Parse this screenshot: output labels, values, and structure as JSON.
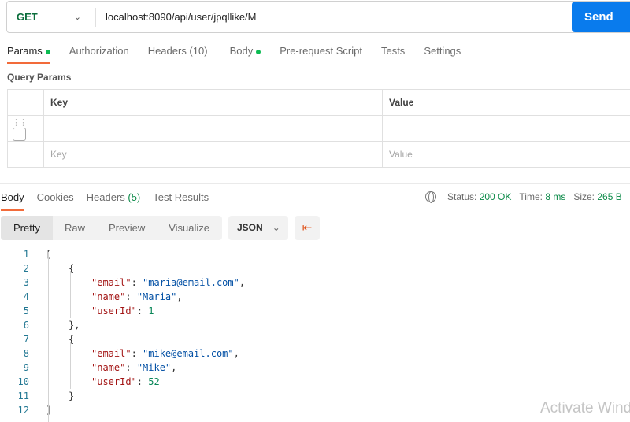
{
  "request": {
    "method": "GET",
    "url": "localhost:8090/api/user/jpqllike/M",
    "send_label": "Send"
  },
  "tabs": [
    "Params",
    "Authorization",
    "Headers (10)",
    "Body",
    "Pre-request Script",
    "Tests",
    "Settings"
  ],
  "query_params": {
    "title": "Query Params",
    "headers": [
      "Key",
      "Value"
    ],
    "placeholder_key": "Key",
    "placeholder_value": "Value"
  },
  "response": {
    "tabs": [
      "Body",
      "Cookies",
      "Headers",
      "Test Results"
    ],
    "headers_count": "(5)",
    "status_label": "Status:",
    "status": "200 OK",
    "time_label": "Time:",
    "time": "8 ms",
    "size_label": "Size:",
    "size": "265 B",
    "views": [
      "Pretty",
      "Raw",
      "Preview",
      "Visualize"
    ],
    "format": "JSON"
  },
  "code_lines": [
    [
      [
        "p",
        "["
      ]
    ],
    [
      [
        "p",
        "{"
      ]
    ],
    [
      [
        "k",
        "\"email\""
      ],
      [
        "p",
        ": "
      ],
      [
        "s",
        "\"maria@email.com\""
      ],
      [
        "p",
        ","
      ]
    ],
    [
      [
        "k",
        "\"name\""
      ],
      [
        "p",
        ": "
      ],
      [
        "s",
        "\"Maria\""
      ],
      [
        "p",
        ","
      ]
    ],
    [
      [
        "k",
        "\"userId\""
      ],
      [
        "p",
        ": "
      ],
      [
        "n",
        "1"
      ]
    ],
    [
      [
        "p",
        "},"
      ]
    ],
    [
      [
        "p",
        "{"
      ]
    ],
    [
      [
        "k",
        "\"email\""
      ],
      [
        "p",
        ": "
      ],
      [
        "s",
        "\"mike@email.com\""
      ],
      [
        "p",
        ","
      ]
    ],
    [
      [
        "k",
        "\"name\""
      ],
      [
        "p",
        ": "
      ],
      [
        "s",
        "\"Mike\""
      ],
      [
        "p",
        ","
      ]
    ],
    [
      [
        "k",
        "\"userId\""
      ],
      [
        "p",
        ": "
      ],
      [
        "n",
        "52"
      ]
    ],
    [
      [
        "p",
        "}"
      ]
    ],
    [
      [
        "p",
        "]"
      ]
    ]
  ],
  "code_indent": [
    0,
    1,
    2,
    2,
    2,
    1,
    1,
    2,
    2,
    2,
    1,
    0
  ],
  "watermark": "Activate Windows"
}
